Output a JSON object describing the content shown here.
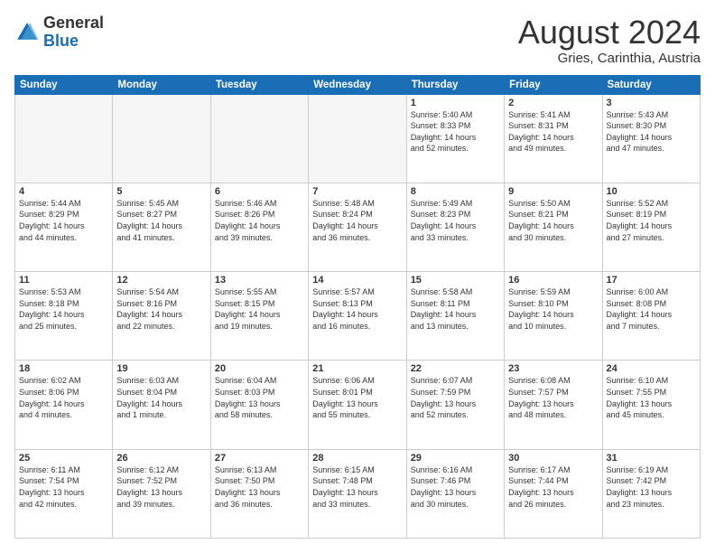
{
  "logo": {
    "line1": "General",
    "line2": "Blue"
  },
  "title": {
    "month_year": "August 2024",
    "location": "Gries, Carinthia, Austria"
  },
  "days_of_week": [
    "Sunday",
    "Monday",
    "Tuesday",
    "Wednesday",
    "Thursday",
    "Friday",
    "Saturday"
  ],
  "weeks": [
    [
      {
        "day": "",
        "empty": true,
        "text": ""
      },
      {
        "day": "",
        "empty": true,
        "text": ""
      },
      {
        "day": "",
        "empty": true,
        "text": ""
      },
      {
        "day": "",
        "empty": true,
        "text": ""
      },
      {
        "day": "1",
        "empty": false,
        "text": "Sunrise: 5:40 AM\nSunset: 8:33 PM\nDaylight: 14 hours\nand 52 minutes."
      },
      {
        "day": "2",
        "empty": false,
        "text": "Sunrise: 5:41 AM\nSunset: 8:31 PM\nDaylight: 14 hours\nand 49 minutes."
      },
      {
        "day": "3",
        "empty": false,
        "text": "Sunrise: 5:43 AM\nSunset: 8:30 PM\nDaylight: 14 hours\nand 47 minutes."
      }
    ],
    [
      {
        "day": "4",
        "empty": false,
        "text": "Sunrise: 5:44 AM\nSunset: 8:29 PM\nDaylight: 14 hours\nand 44 minutes."
      },
      {
        "day": "5",
        "empty": false,
        "text": "Sunrise: 5:45 AM\nSunset: 8:27 PM\nDaylight: 14 hours\nand 41 minutes."
      },
      {
        "day": "6",
        "empty": false,
        "text": "Sunrise: 5:46 AM\nSunset: 8:26 PM\nDaylight: 14 hours\nand 39 minutes."
      },
      {
        "day": "7",
        "empty": false,
        "text": "Sunrise: 5:48 AM\nSunset: 8:24 PM\nDaylight: 14 hours\nand 36 minutes."
      },
      {
        "day": "8",
        "empty": false,
        "text": "Sunrise: 5:49 AM\nSunset: 8:23 PM\nDaylight: 14 hours\nand 33 minutes."
      },
      {
        "day": "9",
        "empty": false,
        "text": "Sunrise: 5:50 AM\nSunset: 8:21 PM\nDaylight: 14 hours\nand 30 minutes."
      },
      {
        "day": "10",
        "empty": false,
        "text": "Sunrise: 5:52 AM\nSunset: 8:19 PM\nDaylight: 14 hours\nand 27 minutes."
      }
    ],
    [
      {
        "day": "11",
        "empty": false,
        "text": "Sunrise: 5:53 AM\nSunset: 8:18 PM\nDaylight: 14 hours\nand 25 minutes."
      },
      {
        "day": "12",
        "empty": false,
        "text": "Sunrise: 5:54 AM\nSunset: 8:16 PM\nDaylight: 14 hours\nand 22 minutes."
      },
      {
        "day": "13",
        "empty": false,
        "text": "Sunrise: 5:55 AM\nSunset: 8:15 PM\nDaylight: 14 hours\nand 19 minutes."
      },
      {
        "day": "14",
        "empty": false,
        "text": "Sunrise: 5:57 AM\nSunset: 8:13 PM\nDaylight: 14 hours\nand 16 minutes."
      },
      {
        "day": "15",
        "empty": false,
        "text": "Sunrise: 5:58 AM\nSunset: 8:11 PM\nDaylight: 14 hours\nand 13 minutes."
      },
      {
        "day": "16",
        "empty": false,
        "text": "Sunrise: 5:59 AM\nSunset: 8:10 PM\nDaylight: 14 hours\nand 10 minutes."
      },
      {
        "day": "17",
        "empty": false,
        "text": "Sunrise: 6:00 AM\nSunset: 8:08 PM\nDaylight: 14 hours\nand 7 minutes."
      }
    ],
    [
      {
        "day": "18",
        "empty": false,
        "text": "Sunrise: 6:02 AM\nSunset: 8:06 PM\nDaylight: 14 hours\nand 4 minutes."
      },
      {
        "day": "19",
        "empty": false,
        "text": "Sunrise: 6:03 AM\nSunset: 8:04 PM\nDaylight: 14 hours\nand 1 minute."
      },
      {
        "day": "20",
        "empty": false,
        "text": "Sunrise: 6:04 AM\nSunset: 8:03 PM\nDaylight: 13 hours\nand 58 minutes."
      },
      {
        "day": "21",
        "empty": false,
        "text": "Sunrise: 6:06 AM\nSunset: 8:01 PM\nDaylight: 13 hours\nand 55 minutes."
      },
      {
        "day": "22",
        "empty": false,
        "text": "Sunrise: 6:07 AM\nSunset: 7:59 PM\nDaylight: 13 hours\nand 52 minutes."
      },
      {
        "day": "23",
        "empty": false,
        "text": "Sunrise: 6:08 AM\nSunset: 7:57 PM\nDaylight: 13 hours\nand 48 minutes."
      },
      {
        "day": "24",
        "empty": false,
        "text": "Sunrise: 6:10 AM\nSunset: 7:55 PM\nDaylight: 13 hours\nand 45 minutes."
      }
    ],
    [
      {
        "day": "25",
        "empty": false,
        "text": "Sunrise: 6:11 AM\nSunset: 7:54 PM\nDaylight: 13 hours\nand 42 minutes."
      },
      {
        "day": "26",
        "empty": false,
        "text": "Sunrise: 6:12 AM\nSunset: 7:52 PM\nDaylight: 13 hours\nand 39 minutes."
      },
      {
        "day": "27",
        "empty": false,
        "text": "Sunrise: 6:13 AM\nSunset: 7:50 PM\nDaylight: 13 hours\nand 36 minutes."
      },
      {
        "day": "28",
        "empty": false,
        "text": "Sunrise: 6:15 AM\nSunset: 7:48 PM\nDaylight: 13 hours\nand 33 minutes."
      },
      {
        "day": "29",
        "empty": false,
        "text": "Sunrise: 6:16 AM\nSunset: 7:46 PM\nDaylight: 13 hours\nand 30 minutes."
      },
      {
        "day": "30",
        "empty": false,
        "text": "Sunrise: 6:17 AM\nSunset: 7:44 PM\nDaylight: 13 hours\nand 26 minutes."
      },
      {
        "day": "31",
        "empty": false,
        "text": "Sunrise: 6:19 AM\nSunset: 7:42 PM\nDaylight: 13 hours\nand 23 minutes."
      }
    ]
  ]
}
